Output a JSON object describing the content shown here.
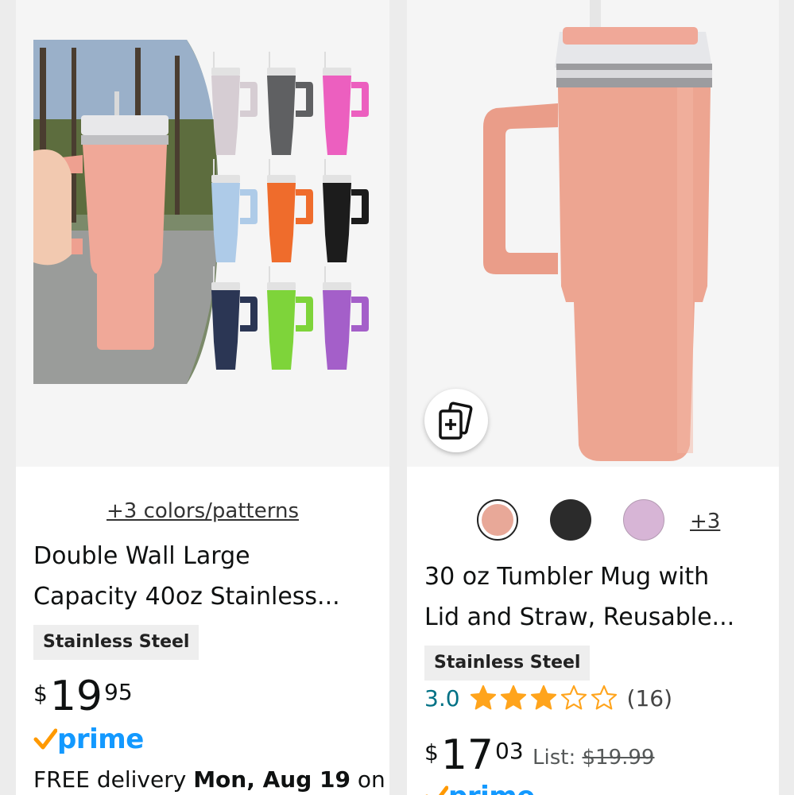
{
  "products": [
    {
      "colors_link": "+3 colors/patterns",
      "title_line1": "Double Wall Large",
      "title_line2": "Capacity 40oz Stainless...",
      "badge": "Stainless Steel",
      "price": {
        "currency": "$",
        "whole": "19",
        "fraction": "95"
      },
      "prime_label": "prime",
      "delivery_prefix": "FREE delivery ",
      "delivery_date": "Mon, Aug 19",
      "delivery_suffix": " on",
      "tumbler_colors": [
        "#d6cdd3",
        "#5f6062",
        "#ec5fbf",
        "#aecbe8",
        "#ef6c2c",
        "#1c1c1c",
        "#2b3654",
        "#7ed43a",
        "#a45fc9"
      ]
    },
    {
      "swatch_colors": [
        "#e8a898",
        "#2b2b2b",
        "#d7b5d6"
      ],
      "more_colors": "+3",
      "title_line1": "30 oz Tumbler Mug with",
      "title_line2": "Lid and Straw, Reusable...",
      "badge": "Stainless Steel",
      "rating_value": "3.0",
      "rating": 3,
      "review_count": "(16)",
      "price": {
        "currency": "$",
        "whole": "17",
        "fraction": "03"
      },
      "list_label": "List: ",
      "list_price": "$19.99",
      "prime_label": "prime",
      "tumbler_color": "#eda591"
    }
  ],
  "colors": {
    "prime_blue": "#1399ff",
    "prime_check": "#ff9900",
    "star": "#ffa41c",
    "rating_text": "#007185"
  }
}
